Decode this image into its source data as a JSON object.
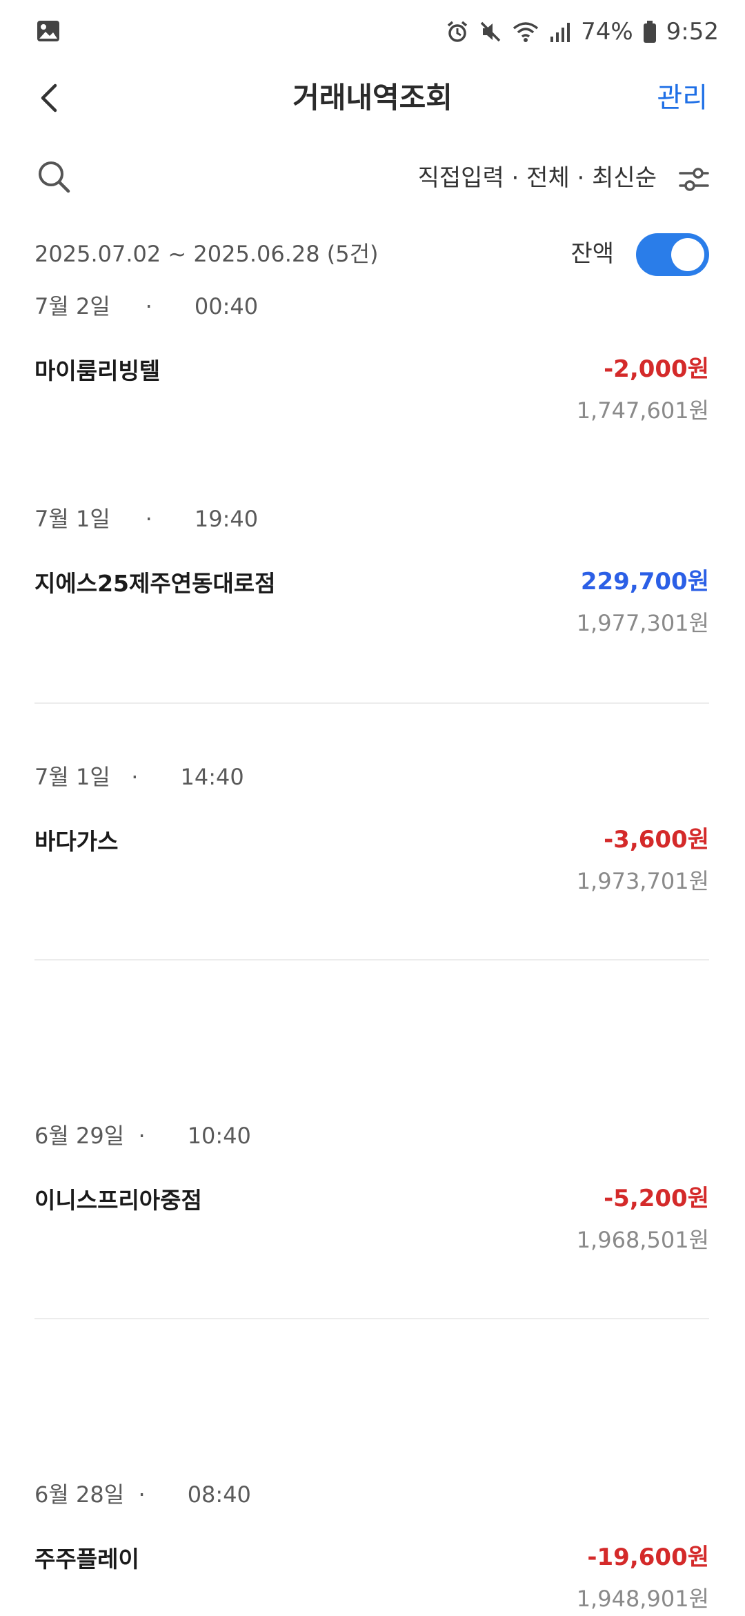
{
  "status_bar": {
    "battery": "74%",
    "time": "9:52",
    "icons": [
      "gallery-icon",
      "alarm-icon",
      "mute-icon",
      "wifi-icon",
      "signal-icon",
      "battery-icon"
    ]
  },
  "header": {
    "title": "거래내역조회",
    "manage_label": "관리"
  },
  "filter": {
    "summary": "직접입력 · 전체 · 최신순"
  },
  "range": {
    "text": "2025.07.02 ~ 2025.06.28 (5건)",
    "balance_label": "잔액",
    "balance_toggle_on": true
  },
  "colors": {
    "accent": "#1e6fe6",
    "toggle": "#2a7de9",
    "withdrawal": "#d42a2a",
    "deposit": "#2b5fe6"
  },
  "transactions": [
    {
      "date": "7월 2일",
      "time": "00:40",
      "name": "마이룸리빙텔",
      "amount": "-2,000원",
      "type": "withdrawal",
      "balance": "1,747,601원"
    },
    {
      "date": "7월 1일",
      "time": "19:40",
      "name": "지에스25제주연동대로점",
      "amount": "229,700원",
      "type": "deposit",
      "balance": "1,977,301원"
    },
    {
      "date": "7월 1일",
      "time": "14:40",
      "name": "바다가스",
      "amount": "-3,600원",
      "type": "withdrawal",
      "balance": "1,973,701원"
    },
    {
      "date": "6월 29일",
      "time": "10:40",
      "name": "이니스프리아중점",
      "amount": "-5,200원",
      "type": "withdrawal",
      "balance": "1,968,501원"
    },
    {
      "date": "6월 28일",
      "time": "08:40",
      "name": "주주플레이",
      "amount": "-19,600원",
      "type": "withdrawal",
      "balance": "1,948,901원"
    }
  ]
}
